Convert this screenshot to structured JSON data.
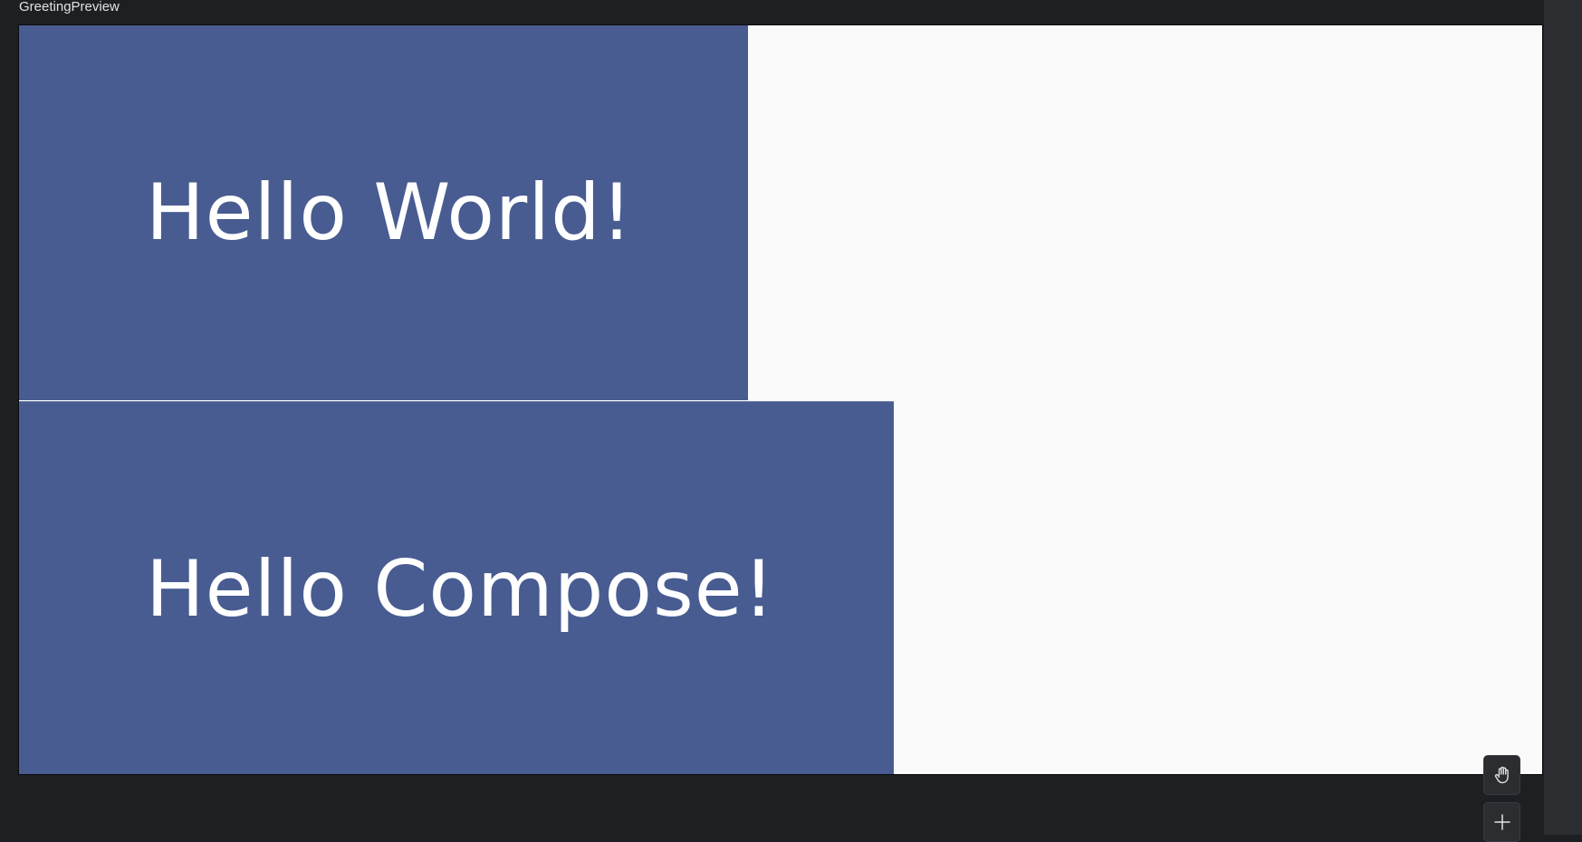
{
  "preview": {
    "title": "GreetingPreview",
    "greetings": [
      {
        "text": "Hello World!"
      },
      {
        "text": "Hello Compose!"
      }
    ]
  },
  "toolbar": {
    "pan_icon": "hand-icon",
    "zoom_in_icon": "plus-icon"
  },
  "colors": {
    "background": "#1e1f22",
    "surface": "#fafafa",
    "greeting_background": "#485c91",
    "greeting_text": "#ffffff"
  }
}
